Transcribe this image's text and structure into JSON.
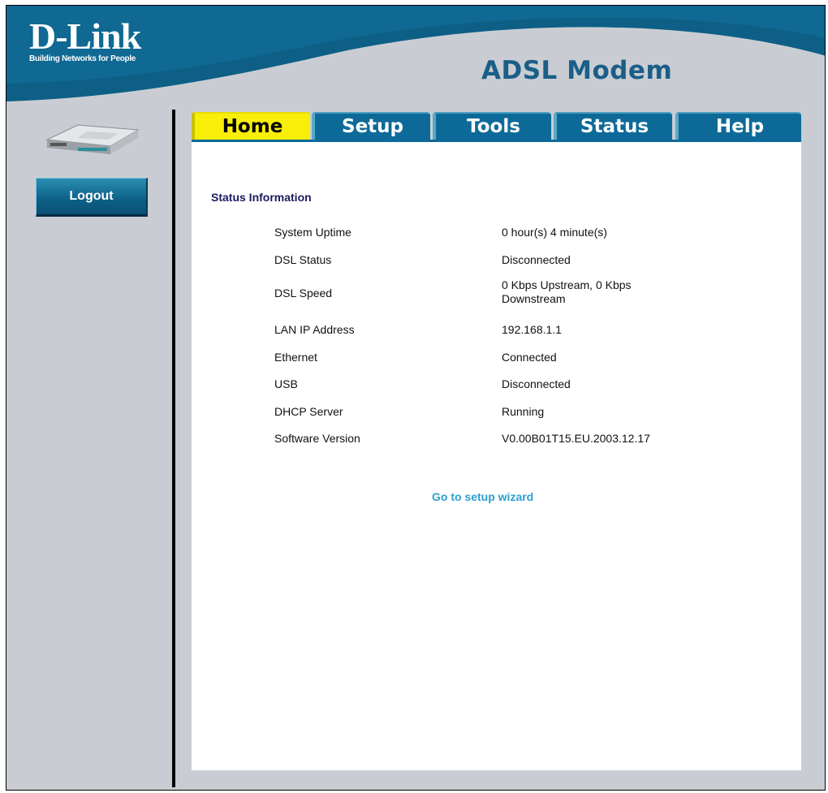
{
  "header": {
    "brand": "D-Link",
    "tagline": "Building Networks for People",
    "product_title": "ADSL Modem"
  },
  "sidebar": {
    "device_image": "adsl-modem-device-image",
    "logout_label": "Logout"
  },
  "tabs": [
    {
      "label": "Home",
      "active": true
    },
    {
      "label": "Setup",
      "active": false
    },
    {
      "label": "Tools",
      "active": false
    },
    {
      "label": "Status",
      "active": false
    },
    {
      "label": "Help",
      "active": false
    }
  ],
  "status": {
    "title": "Status Information",
    "rows": [
      {
        "label": "System Uptime",
        "value": "0 hour(s) 4 minute(s)"
      },
      {
        "label": "DSL Status",
        "value": "Disconnected"
      },
      {
        "label": "DSL Speed",
        "value": "0 Kbps Upstream, 0 Kbps Downstream"
      },
      {
        "label": "LAN IP Address",
        "value": "192.168.1.1"
      },
      {
        "label": "Ethernet",
        "value": "Connected"
      },
      {
        "label": "USB",
        "value": "Disconnected"
      },
      {
        "label": "DHCP Server",
        "value": "Running"
      },
      {
        "label": "Software Version",
        "value": "V0.00B01T15.EU.2003.12.17"
      }
    ]
  },
  "wizard_link": "Go to setup wizard",
  "colors": {
    "header_blue": "#0d5f86",
    "tab_blue": "#0d6a98",
    "tab_active": "#f8ee0a",
    "link": "#2aa0cf",
    "background": "#c9cdd3"
  }
}
